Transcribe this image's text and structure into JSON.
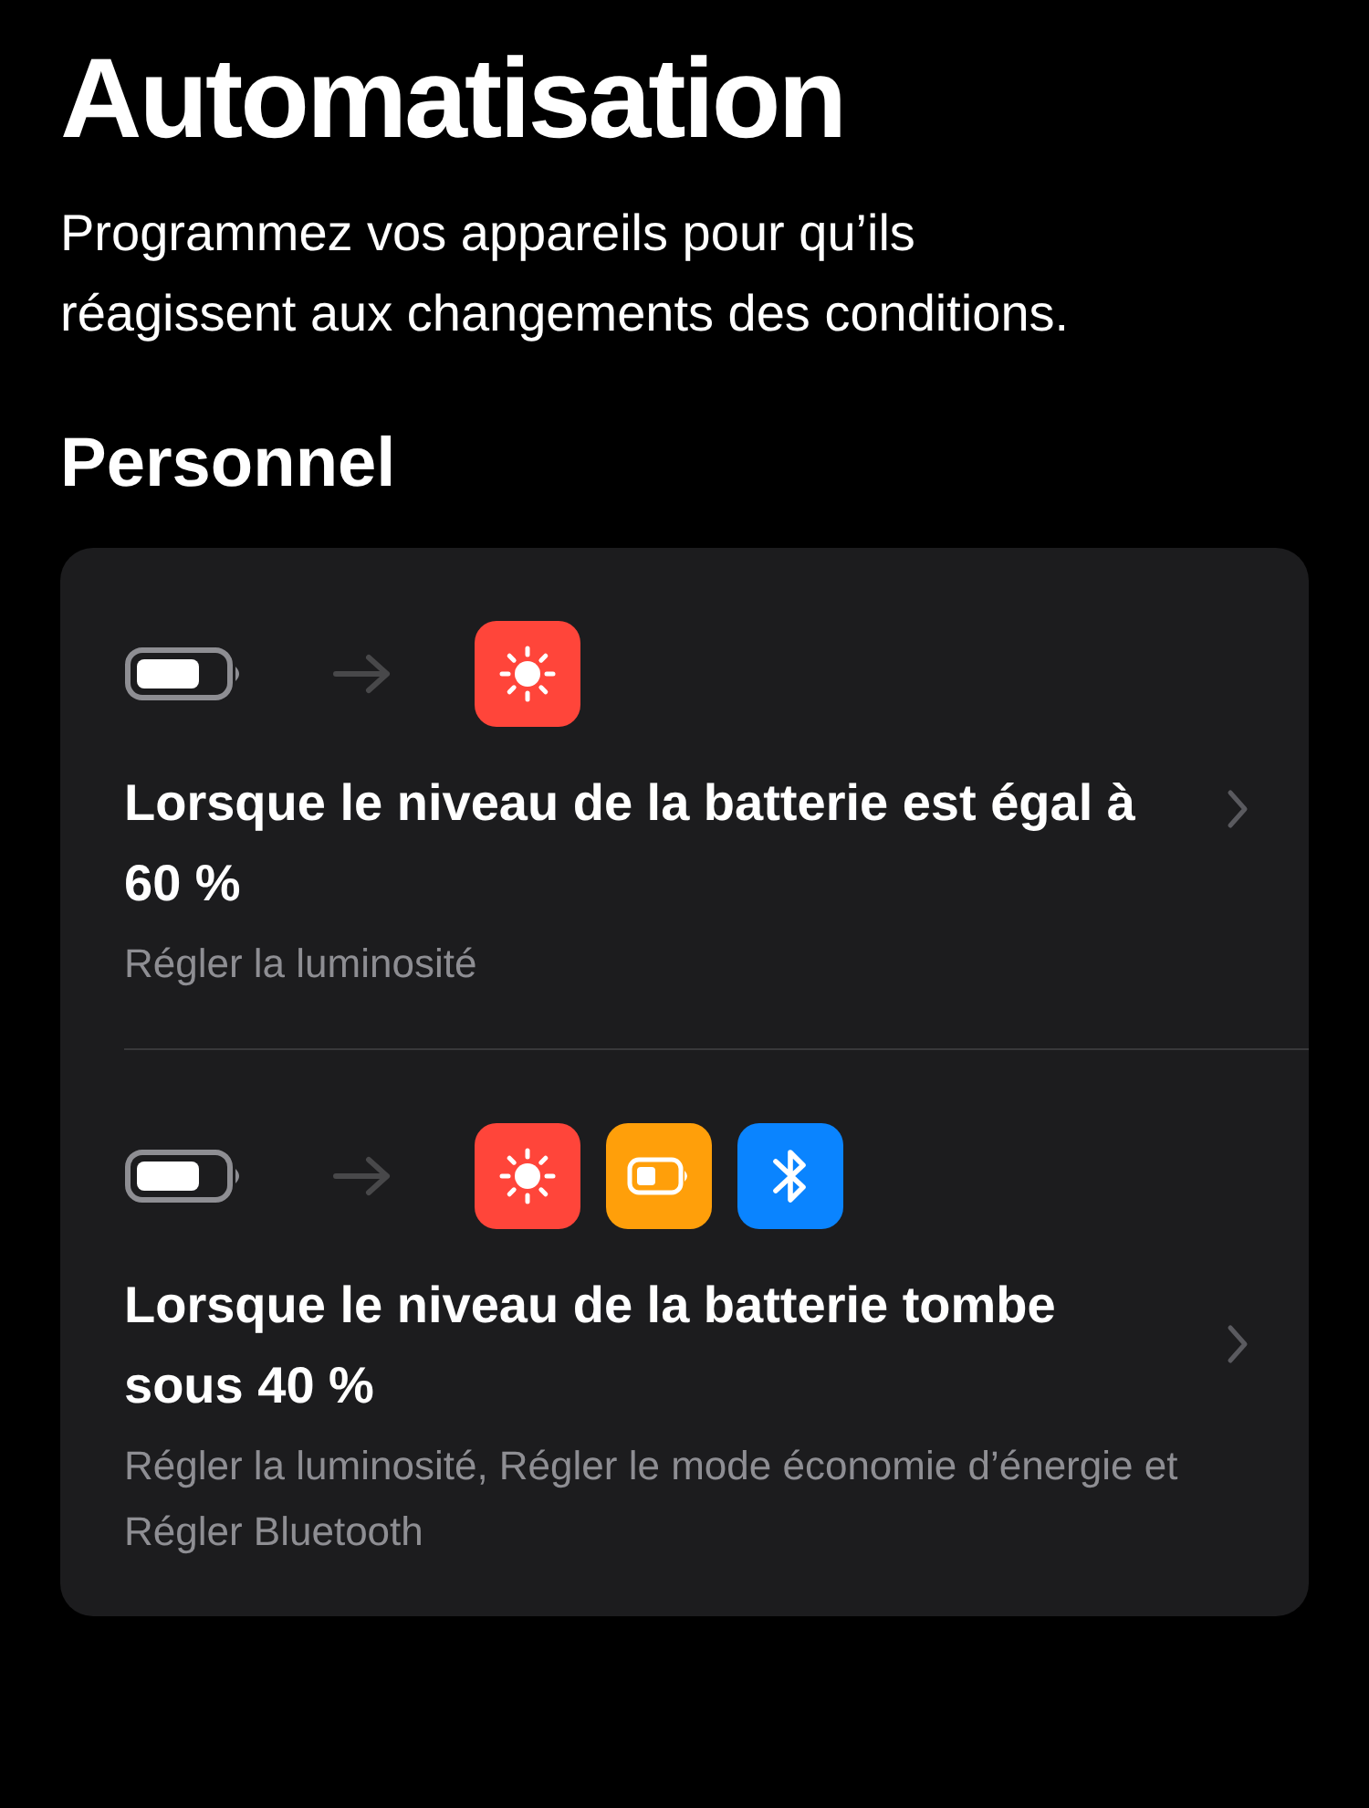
{
  "title": "Automatisation",
  "description": "Programmez vos appareils pour qu’ils réagissent aux changements des conditions.",
  "section": {
    "title": "Personnel",
    "automations": [
      {
        "actions": [
          {
            "kind": "brightness"
          }
        ],
        "title": "Lorsque le niveau de la batterie est égal à 60 %",
        "subtitle": "Régler la luminosité"
      },
      {
        "actions": [
          {
            "kind": "brightness"
          },
          {
            "kind": "low-power"
          },
          {
            "kind": "bluetooth"
          }
        ],
        "title": "Lorsque le niveau de la batterie tombe sous 40 %",
        "subtitle": "Régler la luminosité, Régler le mode économie d’énergie et Régler Bluetooth"
      }
    ]
  }
}
